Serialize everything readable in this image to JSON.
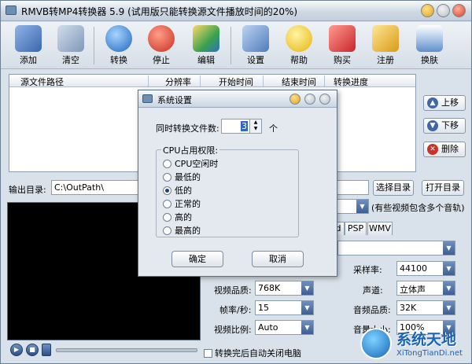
{
  "window": {
    "title": "RMVB转MP4转换器 5.9 (试用版只能转换源文件播放时间的20%)"
  },
  "toolbar": [
    {
      "id": "add",
      "label": "添加",
      "icon": "folder-open-icon",
      "color": "#4d79b8"
    },
    {
      "id": "clear",
      "label": "清空",
      "icon": "trash-can-icon",
      "color": "#7f98b8"
    },
    {
      "id": "convert",
      "label": "转换",
      "icon": "play-icon",
      "color": "#2f7fd1"
    },
    {
      "id": "stop",
      "label": "停止",
      "icon": "power-icon",
      "color": "#d9412e"
    },
    {
      "id": "edit",
      "label": "编辑",
      "icon": "edit-palette-icon",
      "color": "#3aa24c"
    },
    {
      "id": "settings",
      "label": "设置",
      "icon": "gear-settings-icon",
      "color": "#5b86c4"
    },
    {
      "id": "help",
      "label": "帮助",
      "icon": "star-help-icon",
      "color": "#f0c419"
    },
    {
      "id": "buy",
      "label": "购买",
      "icon": "shopping-cart-icon",
      "color": "#d8332f"
    },
    {
      "id": "register",
      "label": "注册",
      "icon": "lock-icon",
      "color": "#e3b02a"
    },
    {
      "id": "skin",
      "label": "换肤",
      "icon": "window-skin-icon",
      "color": "#6d9bd4"
    }
  ],
  "file_list": {
    "columns": [
      "源文件路径",
      "分辨率",
      "开始时间",
      "结束时间",
      "转换进度"
    ]
  },
  "side_buttons": {
    "up": "上移",
    "down": "下移",
    "delete": "删除"
  },
  "output": {
    "label": "输出目录:",
    "path": "C:\\OutPath\\",
    "choose": "选择目录",
    "open": "打开目录"
  },
  "format_hint": "(有些视频包含多个音轨)",
  "tabs": [
    "d",
    "PSP",
    "WMV"
  ],
  "video_settings": {
    "sample_rate_label": "采样率:",
    "sample_rate": "44100",
    "video_quality_label": "视频品质:",
    "video_quality": "768K",
    "channel_label": "声道:",
    "channel": "立体声",
    "framerate_label": "帧率/秒:",
    "framerate": "15",
    "audio_quality_label": "音频品质:",
    "audio_quality": "32K",
    "aspect_label": "视频比例:",
    "aspect": "Auto",
    "volume_label": "音量大小:",
    "volume": "100%"
  },
  "shutdown_label": "转换完后自动关闭电脑",
  "watermark": {
    "title": "系统天地",
    "subtitle": "XiTongTianDi.net"
  },
  "dialog": {
    "title": "系统设置",
    "concurrent_label": "同时转换文件数:",
    "concurrent_value": "3",
    "concurrent_unit": "个",
    "cpu_group": "CPU占用权限:",
    "cpu_options": [
      "CPU空闲时",
      "最低的",
      "低的",
      "正常的",
      "高的",
      "最高的"
    ],
    "cpu_selected_index": 2,
    "ok": "确定",
    "cancel": "取消"
  },
  "colors": {
    "accent": "#3165c3",
    "titlebar": "#cfd9e4",
    "background": "#d9e1ea"
  }
}
